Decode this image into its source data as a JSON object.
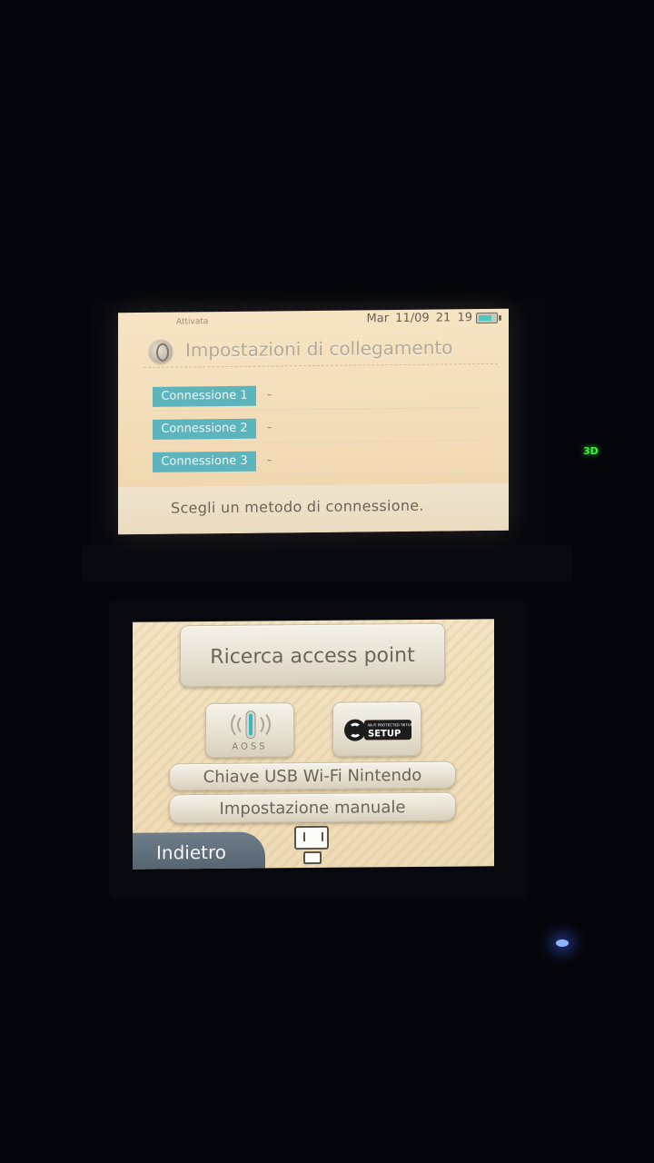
{
  "top_screen": {
    "status": {
      "wifi": "Attivata",
      "date": "Mar 11/09",
      "time": "21 19",
      "battery_icon": "battery-icon"
    },
    "title": "Impostazioni di collegamento",
    "title_icon": "globe-icon",
    "connections": [
      {
        "label": "Connessione 1",
        "value": "-"
      },
      {
        "label": "Connessione 2",
        "value": "-"
      },
      {
        "label": "Connessione 3",
        "value": "-"
      }
    ],
    "footer_message": "Scegli un metodo di connessione.",
    "accent_color": "#5cb5bd"
  },
  "device": {
    "indicator_3d": "3D"
  },
  "bottom_screen": {
    "search_button": "Ricerca access point",
    "aoss_label": "AOSS",
    "wps_label": "Wi-Fi PROTECTED SETUP",
    "wps_badge": "SETUP",
    "usb_button": "Chiave USB Wi-Fi Nintendo",
    "manual_button": "Impostazione manuale",
    "back_button": "Indietro",
    "home_icon": "home-menu-icon"
  }
}
